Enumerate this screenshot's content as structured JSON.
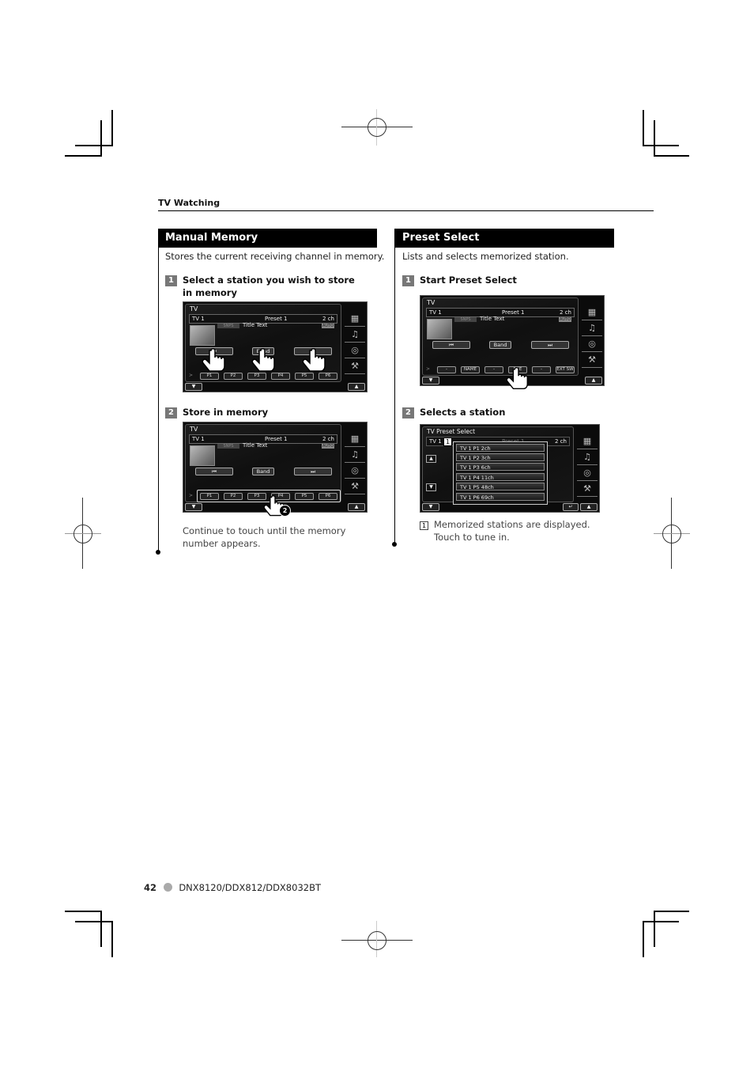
{
  "header": {
    "section_label": "TV Watching"
  },
  "manual_memory": {
    "title": "Manual Memory",
    "description": "Stores the current receiving channel in memory.",
    "steps": [
      {
        "number": "1",
        "label": "Select a station you wish to store in memory"
      },
      {
        "number": "2",
        "label": "Store in memory"
      }
    ],
    "note": "Continue to touch until the memory number appears."
  },
  "preset_select": {
    "title": "Preset Select",
    "description": "Lists and selects memorized station.",
    "steps": [
      {
        "number": "1",
        "label": "Start Preset Select"
      },
      {
        "number": "2",
        "label": "Selects a station"
      }
    ],
    "callout_number": "1",
    "note": "Memorized stations are displayed. Touch to tune in."
  },
  "tv_screen": {
    "title": "TV",
    "source": "TV 1",
    "preset": "Preset 1",
    "channel": "2 ch",
    "snps": "SNPS",
    "title_text": "Title Text",
    "auto": "AUTO",
    "prev_icon": "⏮",
    "band_label": "Band",
    "next_icon": "⏭",
    "more_icon": ">",
    "presets": [
      "P1",
      "P2",
      "P3",
      "P4",
      "P5",
      "P6"
    ],
    "func_buttons": [
      "-",
      "NAME",
      "-",
      "PRE",
      "-",
      "EXT SW"
    ],
    "down_btn": "▼",
    "up_btn": "▲",
    "side_icons": [
      "▦",
      "♫",
      "◎",
      "⚒"
    ],
    "timer_badge": "2"
  },
  "preset_list_screen": {
    "title": "TV Preset Select",
    "source": "TV 1",
    "preset": "Preset 1",
    "channel": "2 ch",
    "up_btn": "▲",
    "down_btn": "▼",
    "return_icon": "↵",
    "stations": [
      "TV 1  P1  2ch",
      "TV 1  P2  3ch",
      "TV 1  P3  6ch",
      "TV 1  P4  11ch",
      "TV 1  P5  48ch",
      "TV 1  P6  69ch"
    ]
  },
  "footer": {
    "page_number": "42",
    "models": "DNX8120/DDX812/DDX8032BT"
  }
}
